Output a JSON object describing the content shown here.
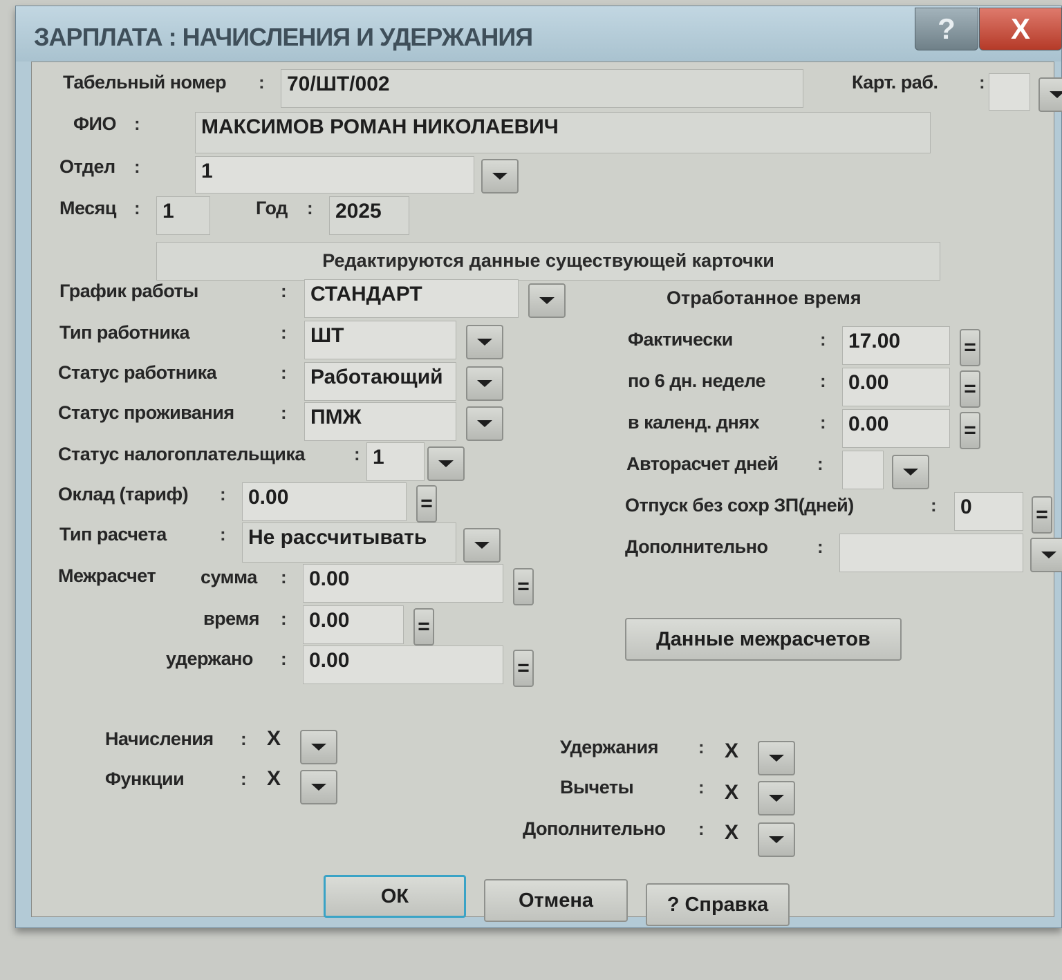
{
  "window": {
    "title": "ЗАРПЛАТА : НАЧИСЛЕНИЯ И УДЕРЖАНИЯ",
    "help_glyph": "?",
    "close_glyph": "X"
  },
  "form": {
    "tab_number": {
      "label": "Табельный номер",
      "value": "70/ШТ/002"
    },
    "card": {
      "label": "Карт. раб.",
      "value": ""
    },
    "fio": {
      "label": "ФИО",
      "value": "МАКСИМОВ РОМАН НИКОЛАЕВИЧ"
    },
    "department": {
      "label": "Отдел",
      "value": "1"
    },
    "month": {
      "label": "Месяц",
      "value": "1"
    },
    "year": {
      "label": "Год",
      "value": "2025"
    },
    "status_banner": "Редактируются данные существующей карточки",
    "schedule": {
      "label": "График работы",
      "value": "СТАНДАРТ"
    },
    "worker_type": {
      "label": "Тип работника",
      "value": "ШТ"
    },
    "worker_status": {
      "label": "Статус работника",
      "value": "Работающий"
    },
    "residence_status": {
      "label": "Статус проживания",
      "value": "ПМЖ"
    },
    "taxpayer_status": {
      "label": "Статус налогоплательщика",
      "value": "1"
    },
    "salary": {
      "label": "Оклад (тариф)",
      "value": "0.00"
    },
    "calc_type": {
      "label": "Тип расчета",
      "value": "Не рассчитывать"
    },
    "intercalc": {
      "label": "Межрасчет",
      "sum": {
        "label": "сумма",
        "value": "0.00"
      },
      "time": {
        "label": "время",
        "value": "0.00"
      },
      "withheld": {
        "label": "удержано",
        "value": "0.00"
      }
    }
  },
  "worked_time": {
    "title": "Отработанное время",
    "actual": {
      "label": "Фактически",
      "value": "17.00"
    },
    "six_day_week": {
      "label": "по 6 дн. неделе",
      "value": "0.00"
    },
    "calendar_days": {
      "label": "в календ. днях",
      "value": "0.00"
    },
    "auto_days": {
      "label": "Авторасчет дней",
      "value": ""
    },
    "unpaid_leave": {
      "label": "Отпуск без сохр ЗП(дней)",
      "value": "0"
    },
    "additional": {
      "label": "Дополнительно",
      "value": ""
    },
    "intercalc_button": "Данные межрасчетов"
  },
  "bottom": {
    "accruals": {
      "label": "Начисления",
      "value": "X"
    },
    "functions": {
      "label": "Функции",
      "value": "X"
    },
    "withholdings": {
      "label": "Удержания",
      "value": "X"
    },
    "deductions": {
      "label": "Вычеты",
      "value": "X"
    },
    "additional": {
      "label": "Дополнительно",
      "value": "X"
    }
  },
  "buttons": {
    "ok": "ОК",
    "cancel": "Отмена",
    "help": "? Справка"
  },
  "glyphs": {
    "colon": ":",
    "equals": "="
  },
  "colors": {
    "accent_focus": "#3aa3c6",
    "close_red": "#c84a38",
    "title_bar": "#b3cad6"
  }
}
